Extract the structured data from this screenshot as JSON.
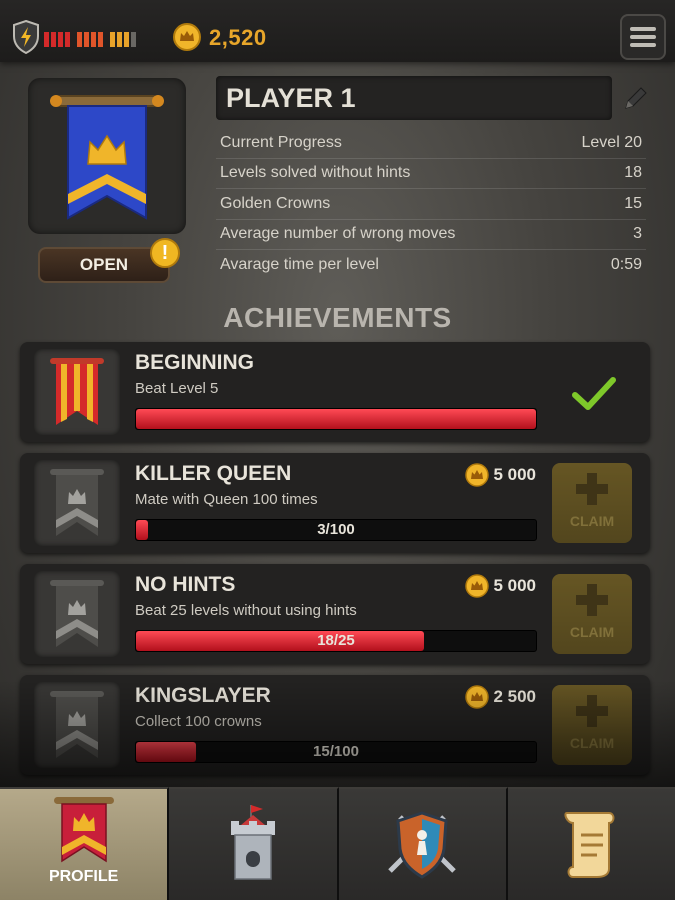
{
  "header": {
    "coins": "2,520",
    "energy_colors": [
      "#d42a2a",
      "#d42a2a",
      "#d42a2a",
      "#d42a2a",
      "#e0552a",
      "#e0552a",
      "#e0552a",
      "#e0552a",
      "#e8a32a",
      "#e8a32a",
      "#e8a32a",
      "#6a6864"
    ],
    "icons": [
      "shield-lightning-icon",
      "crown-coin-icon",
      "hamburger-menu-icon"
    ]
  },
  "profile": {
    "open_label": "OPEN",
    "alert_badge": "!",
    "player_name": "PLAYER 1",
    "stats": [
      {
        "label": "Current Progress",
        "value": "Level 20"
      },
      {
        "label": "Levels solved without hints",
        "value": "18"
      },
      {
        "label": "Golden Crowns",
        "value": "15"
      },
      {
        "label": "Average number of wrong moves",
        "value": "3"
      },
      {
        "label": "Avarage time per level",
        "value": "0:59"
      }
    ]
  },
  "achievements": {
    "title": "ACHIEVEMENTS",
    "items": [
      {
        "title": "BEGINNING",
        "desc": "Beat Level 5",
        "progress_text": "",
        "progress": 1.0,
        "reward": "",
        "claim_label": "",
        "completed": true
      },
      {
        "title": "KILLER QUEEN",
        "desc": "Mate with Queen 100 times",
        "progress_text": "3/100",
        "progress": 0.03,
        "reward": "5 000",
        "claim_label": "CLAIM",
        "completed": false
      },
      {
        "title": "NO HINTS",
        "desc": "Beat 25 levels without using hints",
        "progress_text": "18/25",
        "progress": 0.72,
        "reward": "5 000",
        "claim_label": "CLAIM",
        "completed": false
      },
      {
        "title": "KINGSLAYER",
        "desc": "Collect 100 crowns",
        "progress_text": "15/100",
        "progress": 0.15,
        "reward": "2 500",
        "claim_label": "CLAIM",
        "completed": false
      }
    ]
  },
  "nav": {
    "tabs": [
      {
        "label": "PROFILE",
        "icon": "profile-banner-icon",
        "active": true
      },
      {
        "label": "",
        "icon": "castle-tower-icon",
        "active": false
      },
      {
        "label": "",
        "icon": "shield-swords-icon",
        "active": false
      },
      {
        "label": "",
        "icon": "scroll-icon",
        "active": false
      }
    ]
  },
  "colors": {
    "accent_gold": "#e8a62a",
    "progress_red": "#d81d2a",
    "check_green": "#7ec82a",
    "banner_blue": "#2d48c8"
  }
}
